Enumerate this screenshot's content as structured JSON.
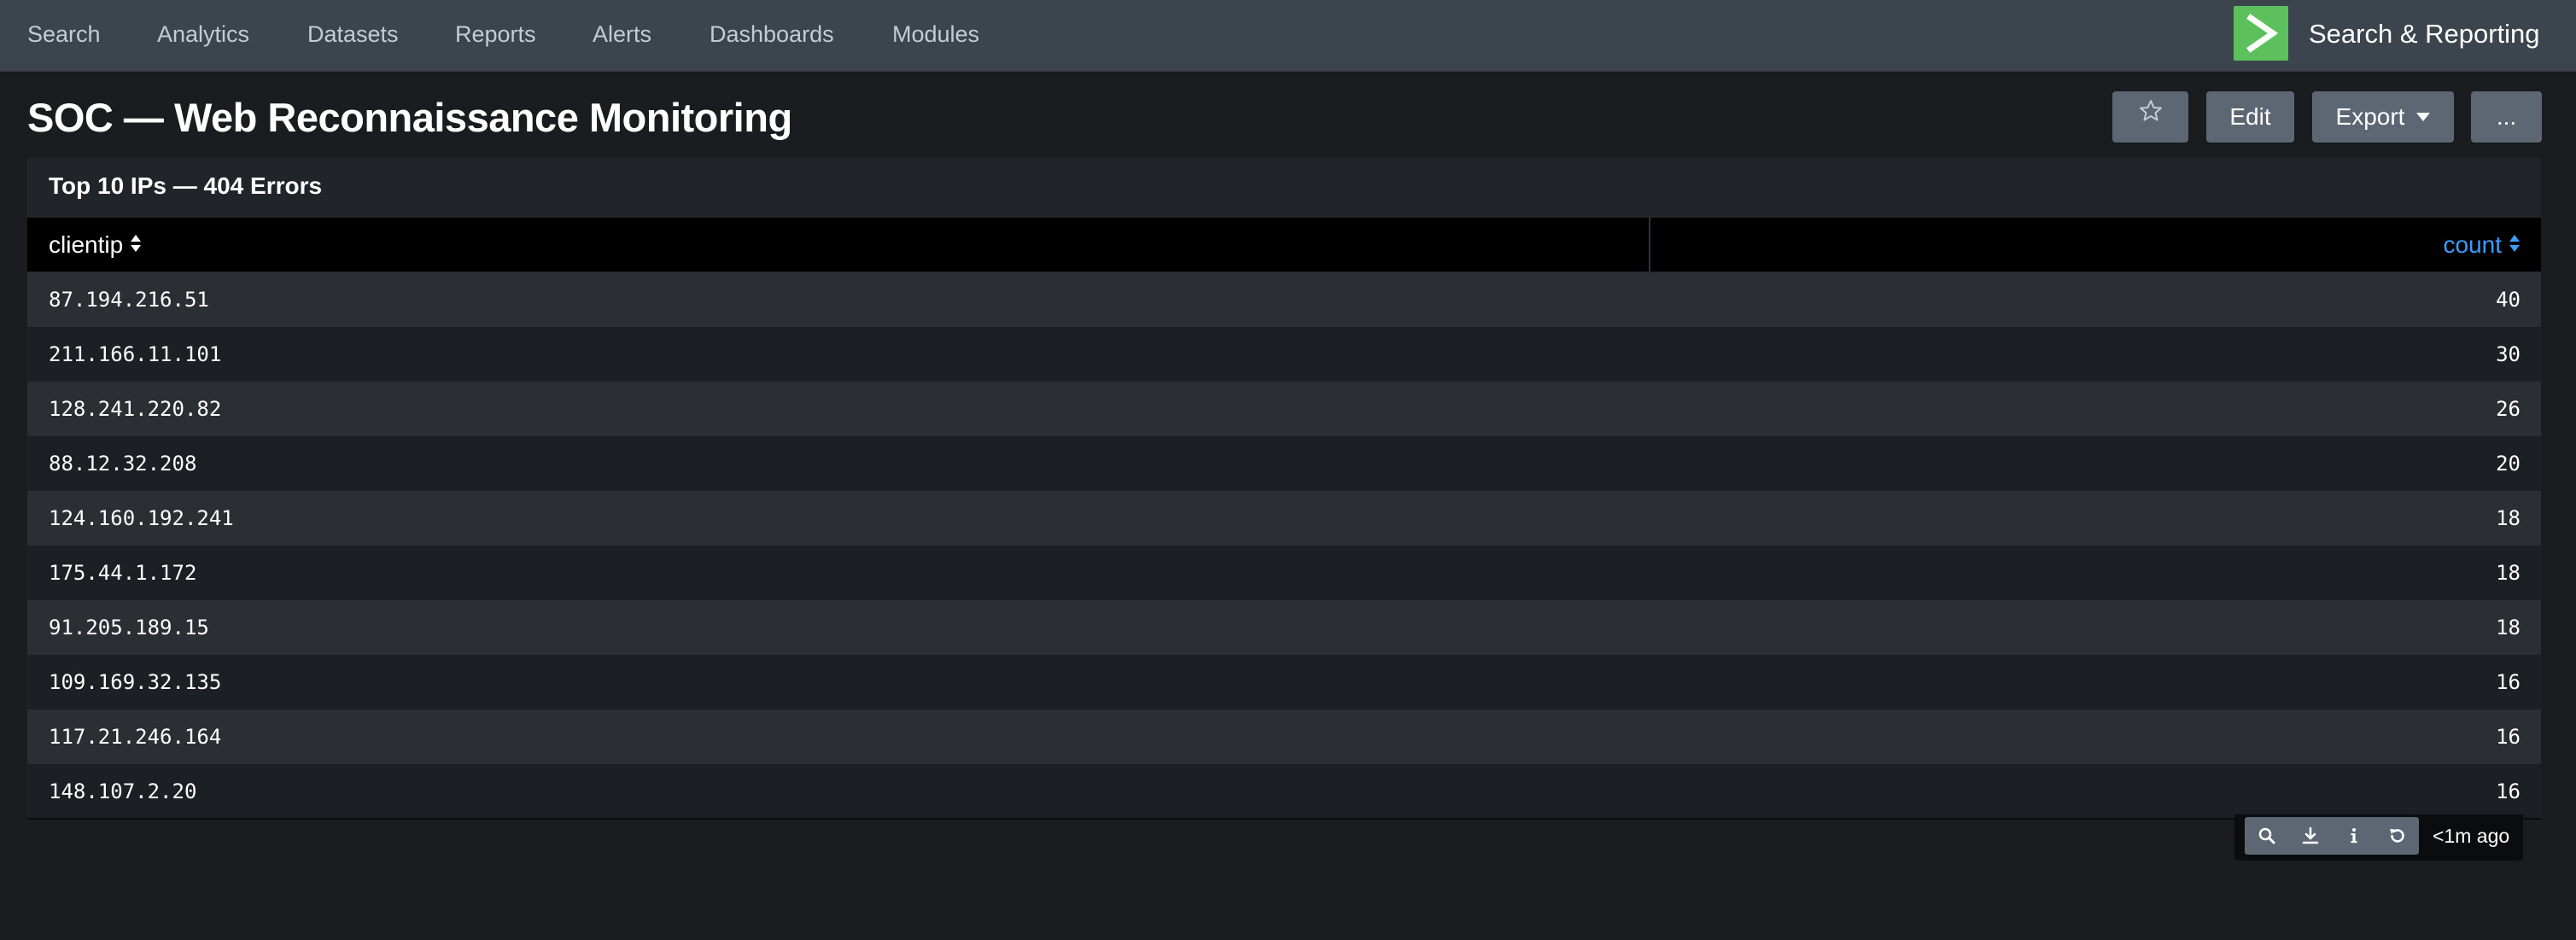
{
  "nav": {
    "items": [
      "Search",
      "Analytics",
      "Datasets",
      "Reports",
      "Alerts",
      "Dashboards",
      "Modules"
    ],
    "app_title": "Search & Reporting"
  },
  "page": {
    "title": "SOC — Web Reconnaissance Monitoring",
    "star_icon": "star-icon",
    "edit_label": "Edit",
    "export_label": "Export",
    "more_label": "..."
  },
  "panel": {
    "title": "Top 10 IPs — 404 Errors",
    "columns": [
      "clientip",
      "count"
    ],
    "rows": [
      {
        "clientip": "87.194.216.51",
        "count": "40"
      },
      {
        "clientip": "211.166.11.101",
        "count": "30"
      },
      {
        "clientip": "128.241.220.82",
        "count": "26"
      },
      {
        "clientip": "88.12.32.208",
        "count": "20"
      },
      {
        "clientip": "124.160.192.241",
        "count": "18"
      },
      {
        "clientip": "175.44.1.172",
        "count": "18"
      },
      {
        "clientip": "91.205.189.15",
        "count": "18"
      },
      {
        "clientip": "109.169.32.135",
        "count": "16"
      },
      {
        "clientip": "117.21.246.164",
        "count": "16"
      },
      {
        "clientip": "148.107.2.20",
        "count": "16"
      }
    ],
    "footer": {
      "icons": [
        "search-icon",
        "download-icon",
        "info-icon",
        "refresh-icon"
      ],
      "timestamp": "<1m ago"
    }
  },
  "colors": {
    "nav_bg": "#3c444d",
    "page_bg": "#1a1c20",
    "logo_green": "#5cc05c",
    "button_bg": "#5c6773",
    "sorted_column_blue": "#3c9cff",
    "row_odd": "#2b2f34",
    "row_even": "#1c1f23"
  }
}
